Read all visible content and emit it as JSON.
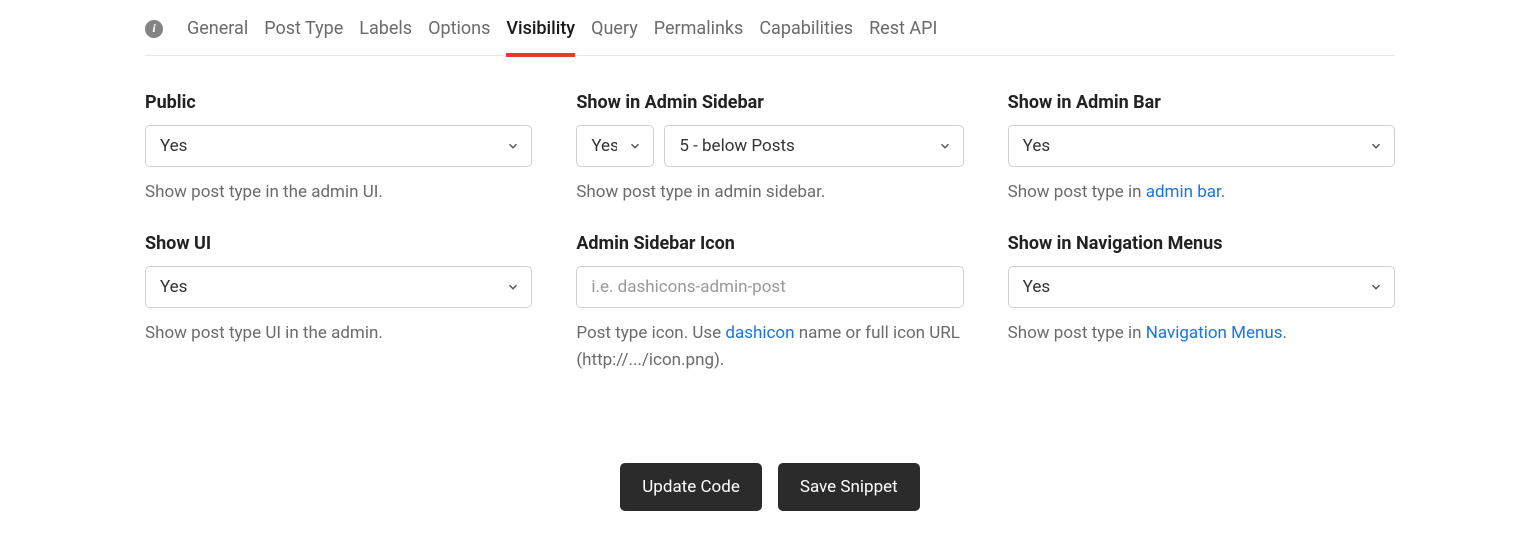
{
  "tabs": {
    "general": "General",
    "post_type": "Post Type",
    "labels": "Labels",
    "options": "Options",
    "visibility": "Visibility",
    "query": "Query",
    "permalinks": "Permalinks",
    "capabilities": "Capabilities",
    "rest_api": "Rest API"
  },
  "fields": {
    "public": {
      "label": "Public",
      "value": "Yes",
      "help": "Show post type in the admin UI."
    },
    "show_admin_sidebar": {
      "label": "Show in Admin Sidebar",
      "value_toggle": "Yes",
      "value_position": "5 - below Posts",
      "help": "Show post type in admin sidebar."
    },
    "show_admin_bar": {
      "label": "Show in Admin Bar",
      "value": "Yes",
      "help_pre": "Show post type in ",
      "help_link": "admin bar",
      "help_post": "."
    },
    "show_ui": {
      "label": "Show UI",
      "value": "Yes",
      "help": "Show post type UI in the admin."
    },
    "admin_sidebar_icon": {
      "label": "Admin Sidebar Icon",
      "placeholder": "i.e. dashicons-admin-post",
      "value": "",
      "help_pre": "Post type icon. Use ",
      "help_link": "dashicon",
      "help_post": " name or full icon URL (http://.../icon.png)."
    },
    "show_nav_menus": {
      "label": "Show in Navigation Menus",
      "value": "Yes",
      "help_pre": "Show post type in ",
      "help_link": "Navigation Menus",
      "help_post": "."
    }
  },
  "buttons": {
    "update_code": "Update Code",
    "save_snippet": "Save Snippet"
  }
}
